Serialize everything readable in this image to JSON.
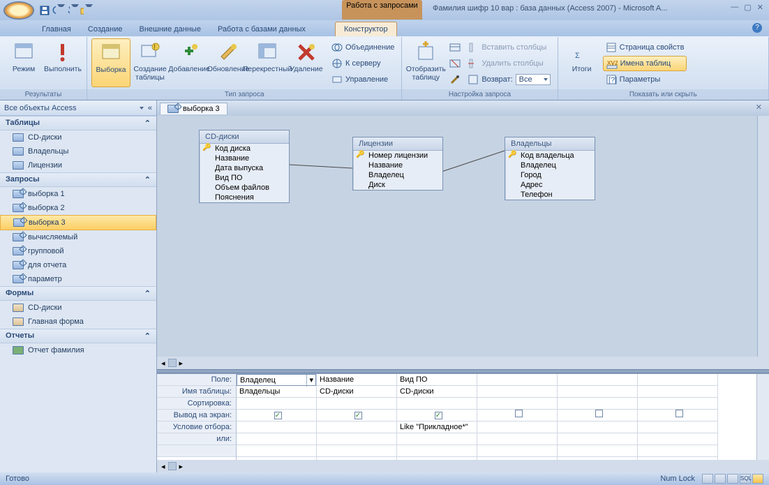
{
  "titlebar": {
    "context_group": "Работа с запросами",
    "title": "Фамилия шифр 10 вар : база данных (Access 2007) - Microsoft A..."
  },
  "tabs": {
    "home": "Главная",
    "create": "Создание",
    "external": "Внешние данные",
    "dbtools": "Работа с базами данных",
    "design": "Конструктор"
  },
  "ribbon": {
    "g1_label": "Результаты",
    "mode": "Режим",
    "run": "Выполнить",
    "g2_label": "Тип запроса",
    "select": "Выборка",
    "maketable": "Создание таблицы",
    "append": "Добавление",
    "update": "Обновление",
    "crosstab": "Перекрестный",
    "delete": "Удаление",
    "union": "Объединение",
    "passthrough": "К серверу",
    "datadef": "Управление",
    "g3_label": "Настройка запроса",
    "showtable": "Отобразить таблицу",
    "insertcols": "Вставить столбцы",
    "deletecols": "Удалить столбцы",
    "return": "Возврат:",
    "return_val": "Все",
    "g4_label": "Показать или скрыть",
    "totals": "Итоги",
    "propsheet": "Страница свойств",
    "tablenames": "Имена таблиц",
    "params": "Параметры"
  },
  "nav": {
    "header": "Все объекты Access",
    "sec_tables": "Таблицы",
    "sec_queries": "Запросы",
    "sec_forms": "Формы",
    "sec_reports": "Отчеты",
    "tables": [
      "CD-диски",
      "Владельцы",
      "Лицензии"
    ],
    "queries": [
      "выборка 1",
      "выборка 2",
      "выборка 3",
      "вычисляемый",
      "групповой",
      "для отчета",
      "параметр"
    ],
    "forms": [
      "CD-диски",
      "Главная форма"
    ],
    "reports": [
      "Отчет фамилия"
    ]
  },
  "doc": {
    "tab": "выборка 3",
    "box1_title": "CD-диски",
    "box1_fields": [
      "Код диска",
      "Название",
      "Дата выпуска",
      "Вид ПО",
      "Объем файлов",
      "Пояснения"
    ],
    "box2_title": "Лицензии",
    "box2_fields": [
      "Номер лицензии",
      "Название",
      "Владелец",
      "Диск"
    ],
    "box3_title": "Владельцы",
    "box3_fields": [
      "Код владельца",
      "Владелец",
      "Город",
      "Адрес",
      "Телефон"
    ]
  },
  "grid": {
    "rowlabels": [
      "Поле:",
      "Имя таблицы:",
      "Сортировка:",
      "Вывод на экран:",
      "Условие отбора:",
      "или:"
    ],
    "cols": [
      {
        "field": "Владелец",
        "table": "Владельцы",
        "show": true,
        "criteria": ""
      },
      {
        "field": "Название",
        "table": "CD-диски",
        "show": true,
        "criteria": ""
      },
      {
        "field": "Вид ПО",
        "table": "CD-диски",
        "show": true,
        "criteria": "Like \"Прикладное*\""
      },
      {
        "field": "",
        "table": "",
        "show": false,
        "criteria": ""
      },
      {
        "field": "",
        "table": "",
        "show": false,
        "criteria": ""
      },
      {
        "field": "",
        "table": "",
        "show": false,
        "criteria": ""
      }
    ],
    "active_col_has_dropdown": true
  },
  "statusbar": {
    "left": "Готово",
    "numlock": "Num Lock"
  }
}
